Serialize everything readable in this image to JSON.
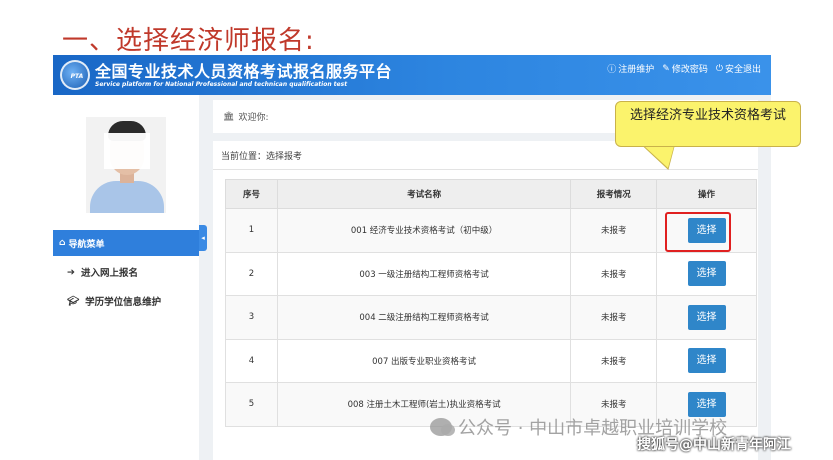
{
  "slide_title": "一、选择经济师报名:",
  "header": {
    "site_title": "全国专业技术人员资格考试报名服务平台",
    "site_subtitle": "Service platform for National Professional and technican qualification test",
    "logo_text": "PTA",
    "links": [
      {
        "icon": "info-icon",
        "label": "注册维护"
      },
      {
        "icon": "edit-icon",
        "label": "修改密码"
      },
      {
        "icon": "power-icon",
        "label": "安全退出"
      }
    ]
  },
  "sidebar": {
    "nav_header": "导航菜单",
    "items": [
      {
        "icon": "sign-in-icon",
        "label": "进入网上报名"
      },
      {
        "icon": "graduation-cap-icon",
        "label": "学历学位信息维护"
      }
    ]
  },
  "welcome": {
    "text": "欢迎你:"
  },
  "breadcrumb": {
    "text": "当前位置：选择报考"
  },
  "table": {
    "columns": [
      "序号",
      "考试名称",
      "报考情况",
      "操作"
    ],
    "rows": [
      {
        "no": "1",
        "name": "001 经济专业技术资格考试（初中级）",
        "status": "未报考",
        "action": "选择"
      },
      {
        "no": "2",
        "name": "003 一级注册结构工程师资格考试",
        "status": "未报考",
        "action": "选择"
      },
      {
        "no": "3",
        "name": "004 二级注册结构工程师资格考试",
        "status": "未报考",
        "action": "选择"
      },
      {
        "no": "4",
        "name": "007 出版专业职业资格考试",
        "status": "未报考",
        "action": "选择"
      },
      {
        "no": "5",
        "name": "008 注册土木工程师(岩土)执业资格考试",
        "status": "未报考",
        "action": "选择"
      }
    ]
  },
  "callout": {
    "text": "选择经济专业技术资格考试"
  },
  "watermarks": {
    "wechat": "公众号 · 中山市卓越职业培训学校",
    "sohu": "搜狐号@中山新青年阿江"
  },
  "colors": {
    "accent": "#2f7fdc",
    "title_red": "#c0392b",
    "callout_yellow": "#fbf36c",
    "highlight_red": "#e02020"
  }
}
